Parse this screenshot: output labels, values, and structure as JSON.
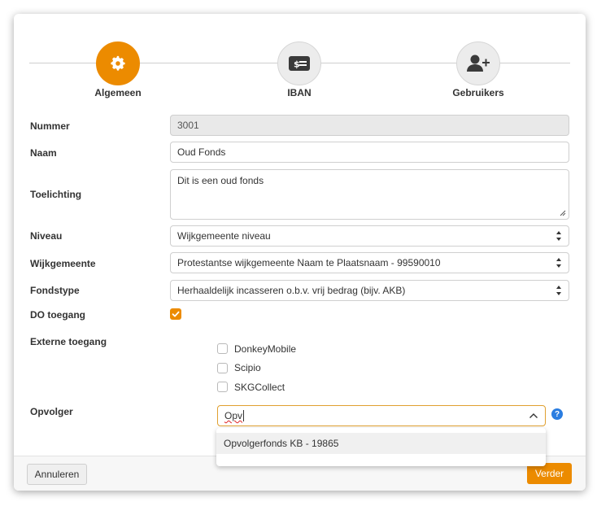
{
  "wizard": {
    "steps": [
      {
        "label": "Algemeen",
        "icon": "gear-icon",
        "active": true
      },
      {
        "label": "IBAN",
        "icon": "money-icon",
        "active": false
      },
      {
        "label": "Gebruikers",
        "icon": "add-user-icon",
        "active": false
      }
    ]
  },
  "form": {
    "nummer": {
      "label": "Nummer",
      "value": "3001"
    },
    "naam": {
      "label": "Naam",
      "value": "Oud Fonds"
    },
    "toelichting": {
      "label": "Toelichting",
      "value": "Dit is een oud fonds"
    },
    "niveau": {
      "label": "Niveau",
      "value": "Wijkgemeente niveau"
    },
    "wijkgemeente": {
      "label": "Wijkgemeente",
      "value": "Protestantse wijkgemeente Naam te Plaatsnaam - 99590010"
    },
    "fondstype": {
      "label": "Fondstype",
      "value": "Herhaaldelijk incasseren o.b.v. vrij bedrag (bijv. AKB)"
    },
    "do_toegang": {
      "label": "DO toegang",
      "checked": true
    },
    "externe_toegang": {
      "label": "Externe toegang",
      "options": [
        {
          "label": "DonkeyMobile",
          "checked": false
        },
        {
          "label": "Scipio",
          "checked": false
        },
        {
          "label": "SKGCollect",
          "checked": false
        }
      ]
    },
    "opvolger": {
      "label": "Opvolger",
      "value": "Opv",
      "help": "?",
      "suggestions": [
        "Opvolgerfonds KB - 19865"
      ]
    }
  },
  "footer": {
    "cancel_label": "Annuleren",
    "next_label": "Verder"
  },
  "colors": {
    "accent": "#ec8b00",
    "help": "#2a7de1"
  }
}
